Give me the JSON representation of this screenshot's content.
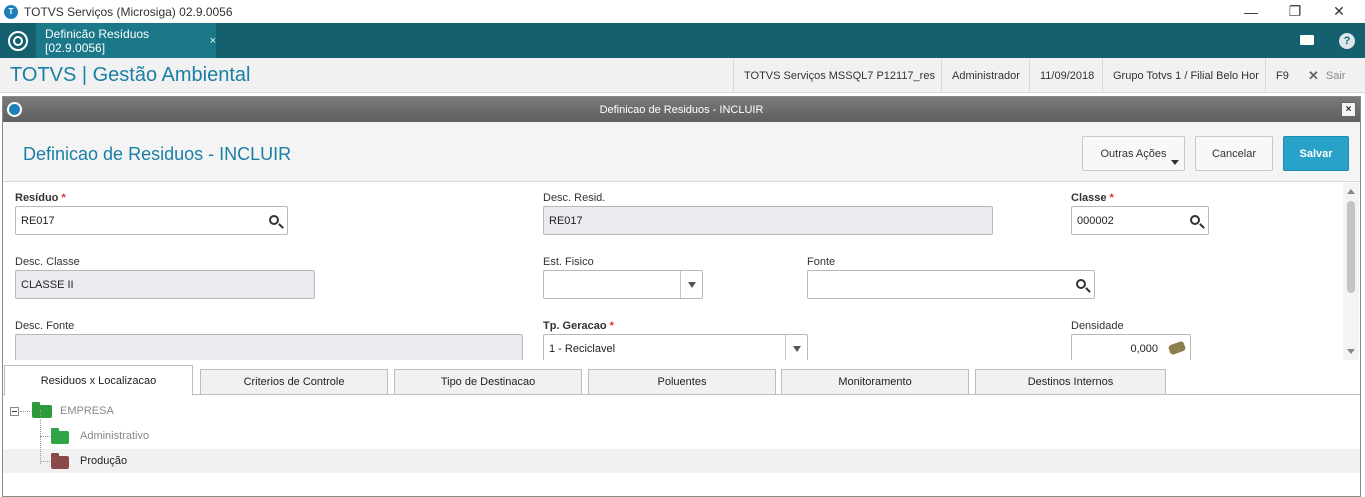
{
  "window": {
    "title": "TOTVS Serviços (Microsiga) 02.9.0056",
    "minimize": "—",
    "restore": "❐",
    "close": "✕"
  },
  "app_tabbar": {
    "active_tab": "Definicão Resíduos [02.9.0056]",
    "tab_close": "×",
    "help": "?"
  },
  "header": {
    "app_name": "TOTVS | Gestão Ambiental",
    "environment": "TOTVS Serviços MSSQL7 P12117_res",
    "user": "Administrador",
    "date": "11/09/2018",
    "branch": "Grupo Totvs 1 / Filial Belo Hor",
    "shortcut": "F9",
    "exit_label": "Sair",
    "exit_icon": "✕"
  },
  "dialog": {
    "title": "Definicao de Residuos - INCLUIR",
    "close": "×",
    "page_title": "Definicao de Residuos - INCLUIR",
    "buttons": {
      "other_actions": "Outras Ações",
      "cancel": "Cancelar",
      "save": "Salvar"
    }
  },
  "form": {
    "residuo": {
      "label": "Resíduo",
      "required": "*",
      "value": "RE017"
    },
    "desc_resid": {
      "label": "Desc. Resid.",
      "value": "RE017"
    },
    "classe": {
      "label": "Classe",
      "required": "*",
      "value": "000002"
    },
    "desc_classe": {
      "label": "Desc. Classe",
      "value": "CLASSE II"
    },
    "est_fisico": {
      "label": "Est. Fisico",
      "value": ""
    },
    "fonte": {
      "label": "Fonte",
      "value": ""
    },
    "desc_fonte": {
      "label": "Desc. Fonte",
      "value": ""
    },
    "tp_geracao": {
      "label": "Tp. Geracao",
      "required": "*",
      "value": "1 - Reciclavel"
    },
    "densidade": {
      "label": "Densidade",
      "value": "0,000"
    }
  },
  "folders": [
    {
      "label": "Residuos x Localizacao",
      "active": true
    },
    {
      "label": "Criterios de Controle",
      "active": false
    },
    {
      "label": "Tipo de Destinacao",
      "active": false
    },
    {
      "label": "Poluentes",
      "active": false
    },
    {
      "label": "Monitoramento",
      "active": false
    },
    {
      "label": "Destinos Internos",
      "active": false
    }
  ],
  "tree": {
    "root": {
      "label": "EMPRESA",
      "color": "#2e9a3a"
    },
    "children": [
      {
        "label": "Administrativo",
        "color": "#2fa548",
        "selected": false
      },
      {
        "label": "Produção",
        "color": "#8a4a4a",
        "selected": true
      }
    ]
  },
  "colors": {
    "tabbar_bg": "#14606e",
    "accent": "#1a7fa6",
    "save_button": "#28a2c8",
    "required_star": "#e03030"
  }
}
